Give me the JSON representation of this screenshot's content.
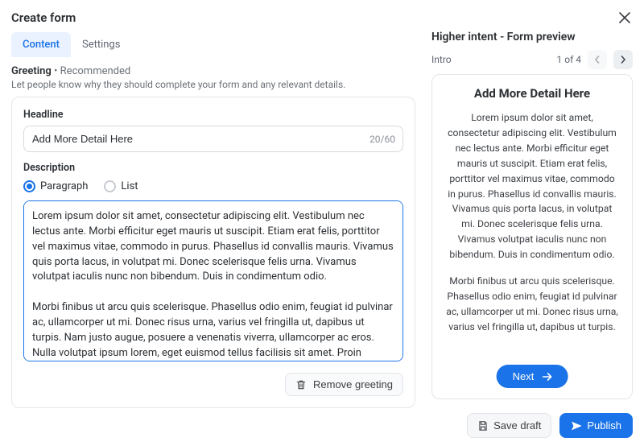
{
  "header": {
    "title": "Create form"
  },
  "tabs": {
    "content": "Content",
    "settings": "Settings"
  },
  "greeting": {
    "label": "Greeting",
    "recommended": "Recommended",
    "sub_pre": "Let people know why they should complete your form and any ",
    "sub_link": "relevant details",
    "sub_post": ".",
    "headline_label": "Headline",
    "headline_value": "Add More Detail Here",
    "headline_counter": "20/60",
    "description_label": "Description",
    "radio_paragraph": "Paragraph",
    "radio_list": "List",
    "textarea_value": "Lorem ipsum dolor sit amet, consectetur adipiscing elit. Vestibulum nec lectus ante. Morbi efficitur eget mauris ut suscipit. Etiam erat felis, porttitor vel maximus vitae, commodo in purus. Phasellus id convallis mauris. Vivamus quis porta lacus, in volutpat mi. Donec scelerisque felis urna. Vivamus volutpat iaculis nunc non bibendum. Duis in condimentum odio.\n\nMorbi finibus ut arcu quis scelerisque. Phasellus odio enim, feugiat id pulvinar ac, ullamcorper ut mi. Donec risus urna, varius vel fringilla ut, dapibus ut turpis. Nam justo augue, posuere a venenatis viverra, ullamcorper ac eros. Nulla volutpat ipsum lorem, eget euismod tellus facilisis sit amet. Proin vulputate at ligula at viverra. Praesent dignissim viverra rutrum. Cras pulvinar libero neque, sit amet eleifend libero fringilla et.\n\nEtiam sapien sem, euismod in rhoncus in, tincidunt sed neque. Fusce imperdiet,",
    "remove_label": "Remove greeting"
  },
  "preview": {
    "title": "Higher intent - Form preview",
    "stage": "Intro",
    "count": "1 of 4",
    "headline": "Add More Detail Here",
    "para1": "Lorem ipsum dolor sit amet, consectetur adipiscing elit. Vestibulum nec lectus ante. Morbi efficitur eget mauris ut suscipit. Etiam erat felis, porttitor vel maximus vitae, commodo in purus. Phasellus id convallis mauris. Vivamus quis porta lacus, in volutpat mi. Donec scelerisque felis urna. Vivamus volutpat iaculis nunc non bibendum. Duis in condimentum odio.",
    "para2": "Morbi finibus ut arcu quis scelerisque. Phasellus odio enim, feugiat id pulvinar ac, ullamcorper ut mi. Donec risus urna, varius vel fringilla ut, dapibus ut turpis.",
    "next_label": "Next"
  },
  "footer": {
    "save_draft": "Save draft",
    "publish": "Publish"
  }
}
